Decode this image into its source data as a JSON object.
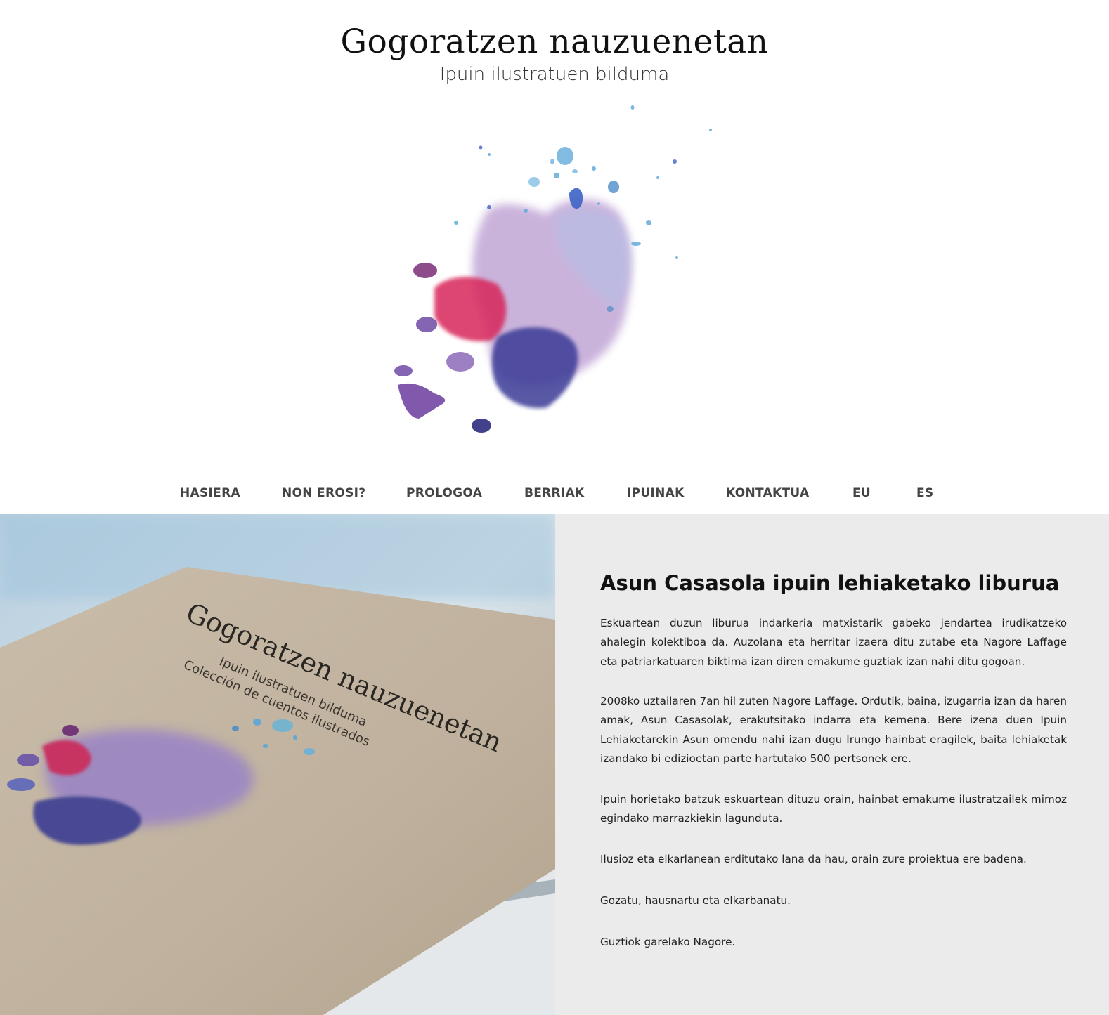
{
  "header": {
    "title": "Gogoratzen nauzuenetan",
    "subtitle": "Ipuin ilustratuen bilduma"
  },
  "nav": {
    "items": [
      {
        "label": "HASIERA"
      },
      {
        "label": "NON EROSI?"
      },
      {
        "label": "PROLOGOA"
      },
      {
        "label": "BERRIAK"
      },
      {
        "label": "IPUINAK"
      },
      {
        "label": "KONTAKTUA"
      },
      {
        "label": "EU"
      },
      {
        "label": "ES"
      }
    ]
  },
  "book_photo": {
    "cover_title": "Gogoratzen nauzuenetan",
    "cover_subtitle_eu": "Ipuin ilustratuen bilduma",
    "cover_subtitle_es": "Colección de cuentos ilustrados"
  },
  "article": {
    "heading": "Asun Casasola ipuin lehiaketako liburua",
    "paragraphs": [
      "Eskuartean duzun liburua indarkeria matxistarik gabeko jendartea irudikatzeko ahalegin kolektiboa da. Auzolana eta herritar izaera ditu zutabe eta Nagore Laffage eta patriarkatuaren biktima izan diren emakume guztiak izan nahi ditu gogoan.",
      "2008ko uztailaren 7an hil zuten Nagore Laffage. Ordutik, baina, izugarria izan da haren amak, Asun Casasolak, erakutsitako indarra eta kemena. Bere izena duen Ipuin Lehiaketarekin Asun omendu nahi izan dugu Irungo hainbat eragilek, baita lehiaketak izandako bi edizioetan parte hartutako 500 pertsonek ere.",
      "Ipuin horietako batzuk eskuartean dituzu orain, hainbat emakume ilustratzailek mimoz egindako marrazkiekin lagunduta.",
      "Ilusioz eta elkarlanean erditutako lana da hau, orain zure proiektua ere badena.",
      "Gozatu, hausnartu eta elkarbanatu.",
      "Guztiok garelako Nagore."
    ]
  },
  "colors": {
    "panel_background": "#ebebeb",
    "nav_text": "#444444",
    "splash_magenta": "#d8265a",
    "splash_violet": "#8a5cb6",
    "splash_indigo": "#3a3a96",
    "splash_blue": "#5aa6d8",
    "cover_kraft": "#c2b4a1"
  }
}
